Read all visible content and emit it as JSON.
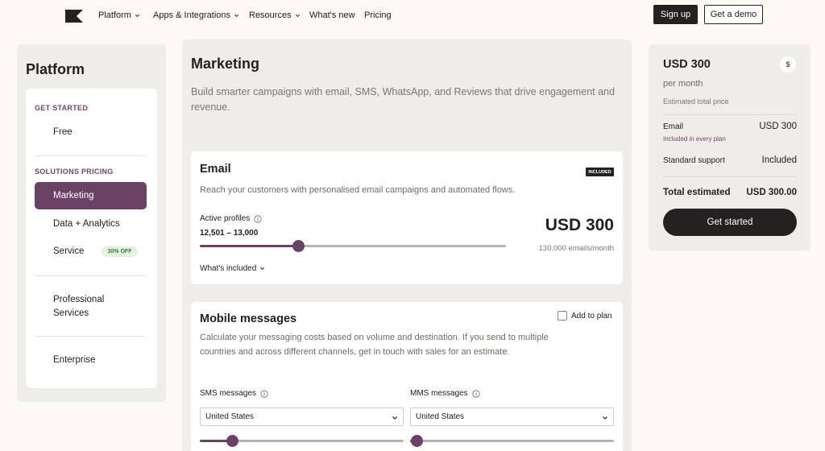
{
  "nav": {
    "items": [
      {
        "label": "Platform",
        "dropdown": true
      },
      {
        "label": "Apps & Integrations",
        "dropdown": true
      },
      {
        "label": "Resources",
        "dropdown": true
      },
      {
        "label": "What's new",
        "dropdown": false
      },
      {
        "label": "Pricing",
        "dropdown": false
      }
    ],
    "signup": "Sign up",
    "demo": "Get a demo"
  },
  "sidebar": {
    "title": "Platform",
    "section_started": "GET STARTED",
    "item_free": "Free",
    "section_solutions": "SOLUTIONS PRICING",
    "item_marketing": "Marketing",
    "item_data": "Data + Analytics",
    "item_service": "Service",
    "service_badge": "30% OFF",
    "item_professional": "Professional\nServices",
    "item_enterprise": "Enterprise"
  },
  "main": {
    "title": "Marketing",
    "description": "Build smarter campaigns with email, SMS, WhatsApp, and Reviews that drive engagement and revenue.",
    "email": {
      "title": "Email",
      "tag": "INCLUDED",
      "description": "Reach your customers with personalised email campaigns and automated flows.",
      "profiles_label": "Active profiles",
      "profiles_range": "12,501 – 13,000",
      "slider_value": 0.32,
      "price": "USD 300",
      "price_sub": "130,000 emails/month",
      "whats_included": "What's included"
    },
    "mobile": {
      "title": "Mobile messages",
      "add_to_plan": "Add to plan",
      "description": "Calculate your messaging costs based on volume and destination. If you send to multiple countries and across different channels, get in touch with sales for an estimate.",
      "sms_label": "SMS messages",
      "sms_country": "United States",
      "sms_slider_value": 0.16,
      "mms_label": "MMS messages",
      "mms_country": "United States",
      "mms_slider_value": 0.03
    }
  },
  "summary": {
    "price": "USD 300",
    "currency_symbol": "$",
    "per_month": "per month",
    "estimated": "Estimated total price",
    "email_label": "Email",
    "email_note": "Included in every plan",
    "email_value": "USD 300",
    "support_label": "Standard support",
    "support_value": "Included",
    "total_label": "Total estimated",
    "total_value": "USD 300.00",
    "cta": "Get started"
  },
  "colors": {
    "accent": "#6B4266",
    "dark": "#232121",
    "page_bg": "#FCF8F3",
    "panel_bg": "#EFEDEA"
  }
}
